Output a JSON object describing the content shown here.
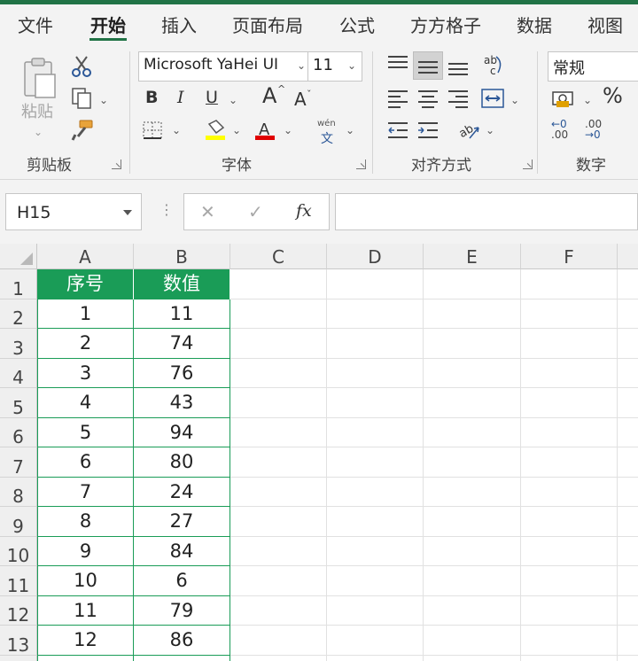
{
  "tabs": [
    "文件",
    "开始",
    "插入",
    "页面布局",
    "公式",
    "方方格子",
    "数据",
    "视图"
  ],
  "active_tab": "开始",
  "ribbon": {
    "clipboard": {
      "paste_label": "粘贴",
      "group_label": "剪贴板"
    },
    "font": {
      "font_name": "Microsoft YaHei UI",
      "font_size": "11",
      "bold": "B",
      "italic": "I",
      "underline": "U",
      "grow": "A",
      "shrink": "A",
      "phonetic_top": "wén",
      "phonetic_bottom": "文",
      "group_label": "字体",
      "fill_color": "#ffff00",
      "font_color": "#e00000"
    },
    "alignment": {
      "group_label": "对齐方式"
    },
    "number": {
      "format": "常规",
      "percent": "%",
      "group_label": "数字",
      "inc_dec_top": "←0",
      "inc_dec_bottom": ".00",
      "dec_dec_top": ".00",
      "dec_dec_bottom": "→0"
    }
  },
  "formula_bar": {
    "name_box": "H15",
    "cancel": "✕",
    "enter": "✓",
    "fx": "fx",
    "value": ""
  },
  "grid": {
    "columns": [
      "A",
      "B",
      "C",
      "D",
      "E",
      "F"
    ],
    "row_numbers": [
      "1",
      "2",
      "3",
      "4",
      "5",
      "6",
      "7",
      "8",
      "9",
      "10",
      "11",
      "12",
      "13"
    ],
    "headers": [
      "序号",
      "数值"
    ],
    "rows": [
      [
        "1",
        "11"
      ],
      [
        "2",
        "74"
      ],
      [
        "3",
        "76"
      ],
      [
        "4",
        "43"
      ],
      [
        "5",
        "94"
      ],
      [
        "6",
        "80"
      ],
      [
        "7",
        "24"
      ],
      [
        "8",
        "27"
      ],
      [
        "9",
        "84"
      ],
      [
        "10",
        "6"
      ],
      [
        "11",
        "79"
      ],
      [
        "12",
        "86"
      ]
    ],
    "header_color": "#1a9c57"
  }
}
